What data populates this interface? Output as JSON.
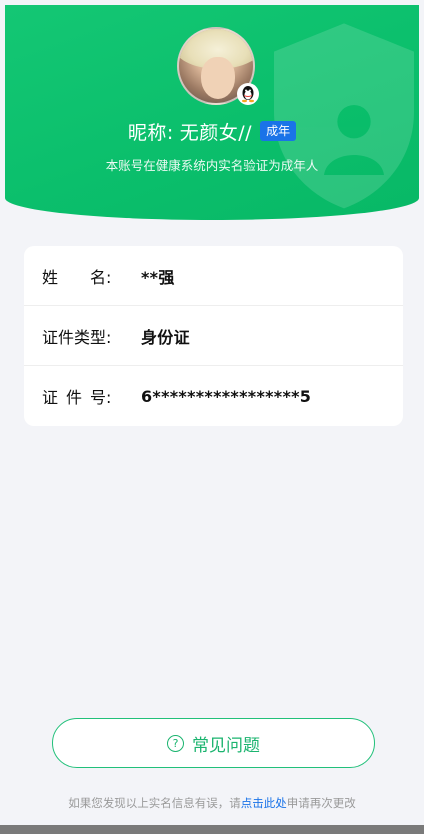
{
  "profile": {
    "nickname_label": "昵称:",
    "nickname": "无颜女//",
    "adult_badge": "成年",
    "subtitle": "本账号在健康系统内实名验证为成年人"
  },
  "info": {
    "rows": [
      {
        "label": "姓　　名:",
        "value": "**强"
      },
      {
        "label": "证件类型:",
        "value": "身份证"
      },
      {
        "label": "证 件 号:",
        "value": "6*****************5"
      }
    ]
  },
  "faq": {
    "icon_glyph": "?",
    "label": "常见问题"
  },
  "footer": {
    "prefix": "如果您发现以上实名信息有误，请",
    "link": "点击此处",
    "suffix": "申请再次更改"
  },
  "colors": {
    "header_green": "#0fc26f",
    "accent_blue": "#1a73e8",
    "button_green": "#1bb46f"
  }
}
